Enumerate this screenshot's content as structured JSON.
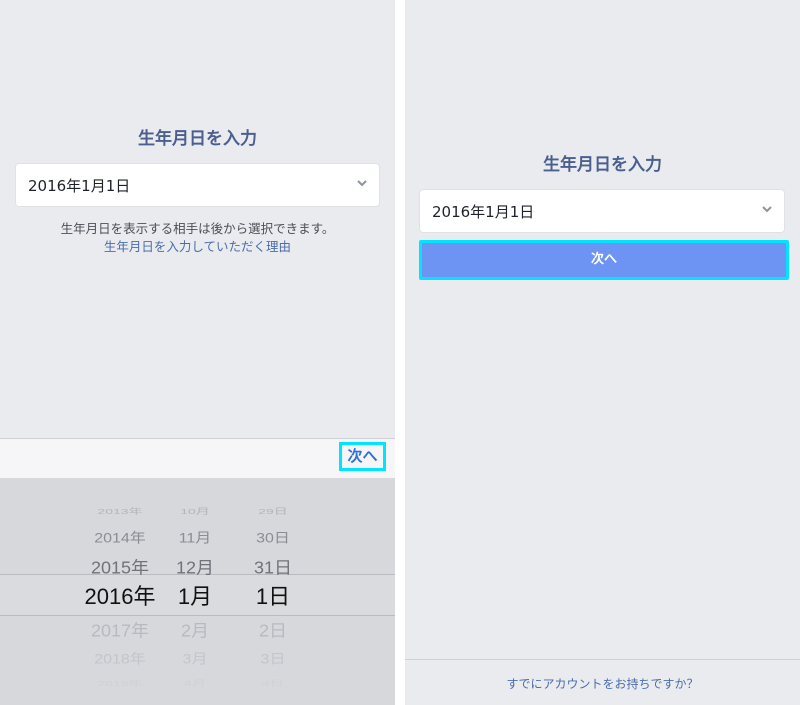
{
  "left": {
    "title": "生年月日を入力",
    "birthday_value": "2016年1月1日",
    "helper_text": "生年月日を表示する相手は後から選択できます。",
    "helper_link": "生年月日を入力していただく理由",
    "toolbar_next": "次へ",
    "picker": {
      "rows": [
        {
          "year": "2013年",
          "month": "10月",
          "day": "29日"
        },
        {
          "year": "2014年",
          "month": "11月",
          "day": "30日"
        },
        {
          "year": "2015年",
          "month": "12月",
          "day": "31日"
        },
        {
          "year": "2016年",
          "month": "1月",
          "day": "1日"
        },
        {
          "year": "2017年",
          "month": "2月",
          "day": "2日"
        },
        {
          "year": "2018年",
          "month": "3月",
          "day": "3日"
        },
        {
          "year": "2019年",
          "month": "4月",
          "day": "4日"
        }
      ],
      "selected_index": 3
    }
  },
  "right": {
    "title": "生年月日を入力",
    "birthday_value": "2016年1月1日",
    "next_button": "次へ",
    "footer_link": "すでにアカウントをお持ちですか？"
  },
  "colors": {
    "background": "#e9ebee",
    "accent_blue": "#6d94f3",
    "highlight": "#00e5ff",
    "link": "#4b6dab",
    "title": "#4b5f8f"
  },
  "icons": {
    "dropdown": "chevron-down-icon"
  }
}
